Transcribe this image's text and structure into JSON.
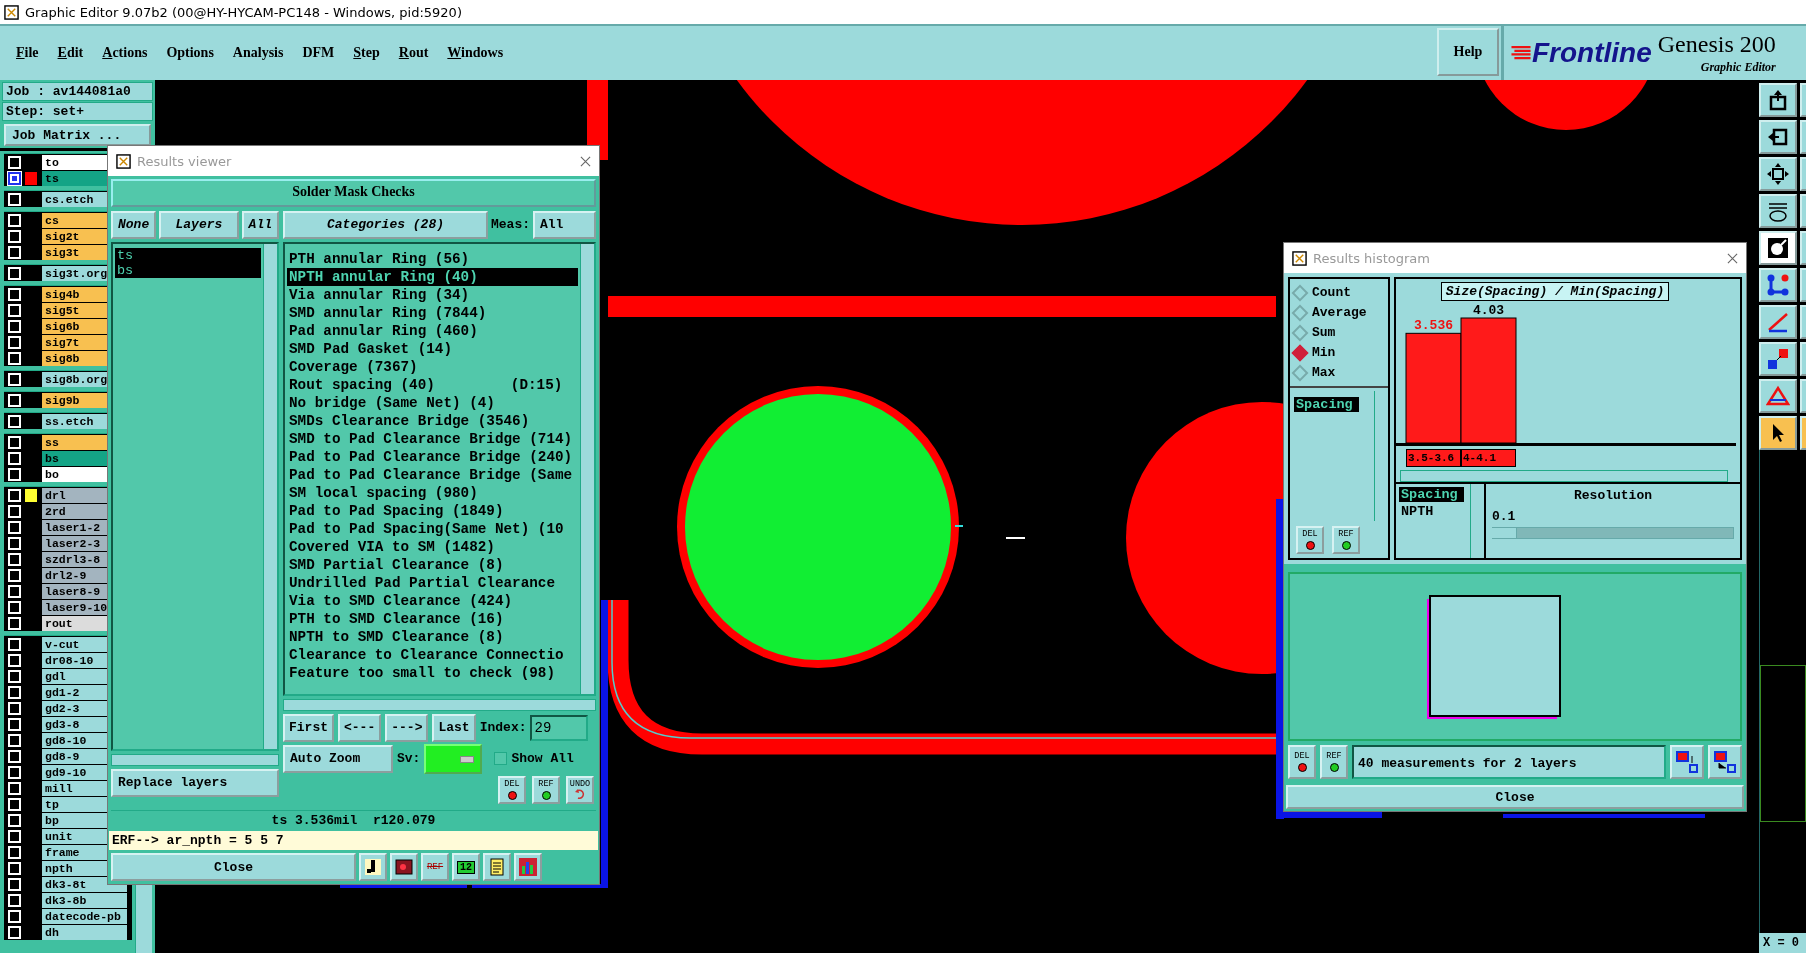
{
  "window": {
    "title": "Graphic Editor 9.07b2 (00@HY-HYCAM-PC148 - Windows, pid:5920)"
  },
  "menu": [
    {
      "label": "File",
      "underline_first": true
    },
    {
      "label": "Edit",
      "underline_first": true
    },
    {
      "label": "Actions",
      "underline_first": true
    },
    {
      "label": "Options",
      "underline_first": false
    },
    {
      "label": "Analysis",
      "underline_first": false
    },
    {
      "label": "DFM",
      "underline_first": false
    },
    {
      "label": "Step",
      "underline_first": true
    },
    {
      "label": "Rout",
      "underline_first": true
    },
    {
      "label": "Windows",
      "underline_first": true
    }
  ],
  "help": "Help",
  "logo": {
    "brand": "Frontline",
    "product": "Genesis 200",
    "subtitle": "Graphic Editor"
  },
  "job": {
    "job": "Job : av144081a0",
    "step": "Step: set+",
    "matrix_button": "Job Matrix ..."
  },
  "layer_groups": [
    {
      "layers": [
        {
          "name": "to",
          "color": "#ffffff",
          "work": false
        },
        {
          "name": "ts",
          "color": "#14a486",
          "work": true,
          "swatch": {
            "color": "#ff0000"
          }
        }
      ]
    },
    {
      "layers": [
        {
          "name": "cs.etch",
          "color": "#9cdadb",
          "work": false
        }
      ]
    },
    {
      "layers": [
        {
          "name": "cs",
          "color": "#f8c050",
          "work": false
        },
        {
          "name": "sig2t",
          "color": "#f8c050",
          "work": false
        },
        {
          "name": "sig3t",
          "color": "#f8c050",
          "work": false
        }
      ]
    },
    {
      "layers": [
        {
          "name": "sig3t.org",
          "color": "#9cdadb",
          "work": false
        }
      ]
    },
    {
      "layers": [
        {
          "name": "sig4b",
          "color": "#f8c050",
          "work": false
        },
        {
          "name": "sig5t",
          "color": "#f8c050",
          "work": false
        },
        {
          "name": "sig6b",
          "color": "#f8c050",
          "work": false
        },
        {
          "name": "sig7t",
          "color": "#f8c050",
          "work": false
        },
        {
          "name": "sig8b",
          "color": "#f8c050",
          "work": false
        }
      ]
    },
    {
      "layers": [
        {
          "name": "sig8b.org",
          "color": "#9cdadb",
          "work": false
        }
      ]
    },
    {
      "layers": [
        {
          "name": "sig9b",
          "color": "#f8c050",
          "work": false
        }
      ]
    },
    {
      "layers": [
        {
          "name": "ss.etch",
          "color": "#9cdadb",
          "work": false
        }
      ]
    },
    {
      "layers": [
        {
          "name": "ss",
          "color": "#f8c050",
          "work": false
        },
        {
          "name": "bs",
          "color": "#14a486",
          "work": false
        },
        {
          "name": "bo",
          "color": "#ffffff",
          "work": false
        }
      ]
    },
    {
      "layers": [
        {
          "name": "drl",
          "color": "#a3b4bf",
          "work": false,
          "swatch": {
            "color": "#ffff33"
          }
        },
        {
          "name": "2rd",
          "color": "#a3b4bf",
          "work": false
        },
        {
          "name": "laser1-2",
          "color": "#a3b4bf",
          "work": false
        },
        {
          "name": "laser2-3",
          "color": "#a3b4bf",
          "work": false
        },
        {
          "name": "szdrl3-8",
          "color": "#a3b4bf",
          "work": false
        },
        {
          "name": "drl2-9",
          "color": "#a3b4bf",
          "work": false
        },
        {
          "name": "laser8-9",
          "color": "#a3b4bf",
          "work": false
        },
        {
          "name": "laser9-10",
          "color": "#a3b4bf",
          "work": false
        },
        {
          "name": "rout",
          "color": "#dcdcdc",
          "work": false
        }
      ]
    },
    {
      "layers": [
        {
          "name": "v-cut",
          "color": "#9cdadb",
          "work": false
        },
        {
          "name": "dr08-10",
          "color": "#9cdadb",
          "work": false
        },
        {
          "name": "gdl",
          "color": "#9cdadb",
          "work": false
        },
        {
          "name": "gd1-2",
          "color": "#9cdadb",
          "work": false
        },
        {
          "name": "gd2-3",
          "color": "#9cdadb",
          "work": false
        },
        {
          "name": "gd3-8",
          "color": "#9cdadb",
          "work": false
        },
        {
          "name": "gd8-10",
          "color": "#9cdadb",
          "work": false
        },
        {
          "name": "gd8-9",
          "color": "#9cdadb",
          "work": false
        },
        {
          "name": "gd9-10",
          "color": "#9cdadb",
          "work": false
        },
        {
          "name": "mill",
          "color": "#9cdadb",
          "work": false
        },
        {
          "name": "tp",
          "color": "#9cdadb",
          "work": false
        },
        {
          "name": "bp",
          "color": "#9cdadb",
          "work": false
        },
        {
          "name": "unit",
          "color": "#9cdadb",
          "work": false
        },
        {
          "name": "frame",
          "color": "#9cdadb",
          "work": false
        },
        {
          "name": "npth",
          "color": "#9cdadb",
          "work": false
        },
        {
          "name": "dk3-8t",
          "color": "#9cdadb",
          "work": false
        },
        {
          "name": "dk3-8b",
          "color": "#9cdadb",
          "work": false
        },
        {
          "name": "datecode-pb",
          "color": "#9cdadb",
          "work": false
        },
        {
          "name": "dh",
          "color": "#9cdadb",
          "work": false
        }
      ]
    }
  ],
  "results_viewer": {
    "title": "Results viewer",
    "heading": "Solder Mask Checks",
    "none_button": "None",
    "layers_label": "Layers",
    "all_button": "All",
    "layers": [
      {
        "name": "ts",
        "selected": true
      },
      {
        "name": "bs",
        "selected": true
      }
    ],
    "replace": "Replace layers",
    "categories_button": "Categories (28)",
    "meas_label": "Meas:",
    "meas_value": "All",
    "categories": [
      {
        "label": "PTH annular Ring (56)",
        "selected": false
      },
      {
        "label": "NPTH annular Ring (40)",
        "selected": true
      },
      {
        "label": "Via annular Ring (34)",
        "selected": false
      },
      {
        "label": "SMD annular Ring (7844)",
        "selected": false
      },
      {
        "label": "Pad annular Ring (460)",
        "selected": false
      },
      {
        "label": "SMD Pad Gasket (14)",
        "selected": false
      },
      {
        "label": "Coverage (7367)",
        "selected": false
      },
      {
        "label": "Rout spacing (40)",
        "selected": false,
        "note": "(D:15)"
      },
      {
        "label": "No bridge (Same Net) (4)",
        "selected": false
      },
      {
        "label": "SMDs Clearance Bridge (3546)",
        "selected": false
      },
      {
        "label": "SMD to Pad Clearance Bridge (714)",
        "selected": false
      },
      {
        "label": "Pad to Pad Clearance Bridge (240)",
        "selected": false
      },
      {
        "label": "Pad to Pad Clearance Bridge (Same",
        "selected": false
      },
      {
        "label": "SM local spacing (980)",
        "selected": false
      },
      {
        "label": "Pad to Pad Spacing (1849)",
        "selected": false
      },
      {
        "label": "Pad to Pad Spacing(Same Net) (10",
        "selected": false
      },
      {
        "label": "Covered VIA to SM (1482)",
        "selected": false
      },
      {
        "label": "SMD Partial Clearance (8)",
        "selected": false
      },
      {
        "label": "Undrilled Pad Partial Clearance",
        "selected": false
      },
      {
        "label": "Via to SMD Clearance (424)",
        "selected": false
      },
      {
        "label": "PTH to SMD Clearance (16)",
        "selected": false
      },
      {
        "label": "NPTH to SMD Clearance (8)",
        "selected": false
      },
      {
        "label": "Clearance to Clearance Connectio",
        "selected": false
      },
      {
        "label": "Feature too small to check (98)",
        "selected": false
      }
    ],
    "nav": [
      "First",
      "<---",
      "--->",
      "Last"
    ],
    "index_label": "Index:",
    "index_value": "29",
    "auto_zoom": "Auto Zoom",
    "sv_label": "Sv:",
    "show_all": {
      "label": "Show All",
      "checked": false
    },
    "actions": [
      {
        "kind": "del",
        "label": "DEL"
      },
      {
        "kind": "ref",
        "label": "REF"
      },
      {
        "kind": "undo",
        "label": "UNDO"
      }
    ],
    "status": "ts 3.536mil  r120.079",
    "erf": "ERF--> ar_npth = 5 5 7",
    "close": "Close",
    "tools": [
      {
        "kind": "figure"
      },
      {
        "kind": "record"
      },
      {
        "kind": "noref",
        "label": "REF"
      },
      {
        "kind": "page",
        "label": "12"
      },
      {
        "kind": "report"
      },
      {
        "kind": "chart"
      }
    ]
  },
  "histogram": {
    "title": "Results histogram",
    "modes": [
      {
        "label": "Count",
        "selected": false
      },
      {
        "label": "Average",
        "selected": false
      },
      {
        "label": "Sum",
        "selected": false
      },
      {
        "label": "Min",
        "selected": true
      },
      {
        "label": "Max",
        "selected": false
      }
    ],
    "fields": [
      {
        "label": "Spacing",
        "selected": true
      }
    ],
    "chart_data": {
      "type": "bar",
      "title": "Size(Spacing) / Min(Spacing)",
      "categories": [
        "3.5-3.6",
        "4-4.1"
      ],
      "values": [
        3.536,
        4.03
      ],
      "value_labels": [
        "3.536",
        "4.03"
      ]
    },
    "types": [
      {
        "label": "Spacing",
        "selected": true
      },
      {
        "label": "NPTH",
        "selected": false
      }
    ],
    "resolution": {
      "label": "Resolution",
      "value": "0.1",
      "level": 0.1
    },
    "list_actions": [
      {
        "kind": "del",
        "label": "DEL"
      },
      {
        "kind": "ref",
        "label": "REF"
      }
    ],
    "actions": [
      {
        "kind": "del",
        "label": "DEL"
      },
      {
        "kind": "ref",
        "label": "REF"
      }
    ],
    "summary": "40 measurements for 2 layers",
    "close": "Close"
  },
  "toolbar": {
    "tools": [
      {
        "kind": "export",
        "selected": false
      },
      {
        "kind": "import",
        "selected": false
      },
      {
        "kind": "fit",
        "selected": false
      },
      {
        "kind": "tools",
        "selected": false
      },
      {
        "kind": "snap",
        "selected": false
      },
      {
        "kind": "nodes",
        "selected": false
      },
      {
        "kind": "angle",
        "selected": false
      },
      {
        "kind": "squares",
        "selected": false
      },
      {
        "kind": "triangle",
        "selected": false
      },
      {
        "kind": "pointer",
        "selected": true
      }
    ],
    "coordinate": "X = 0"
  }
}
